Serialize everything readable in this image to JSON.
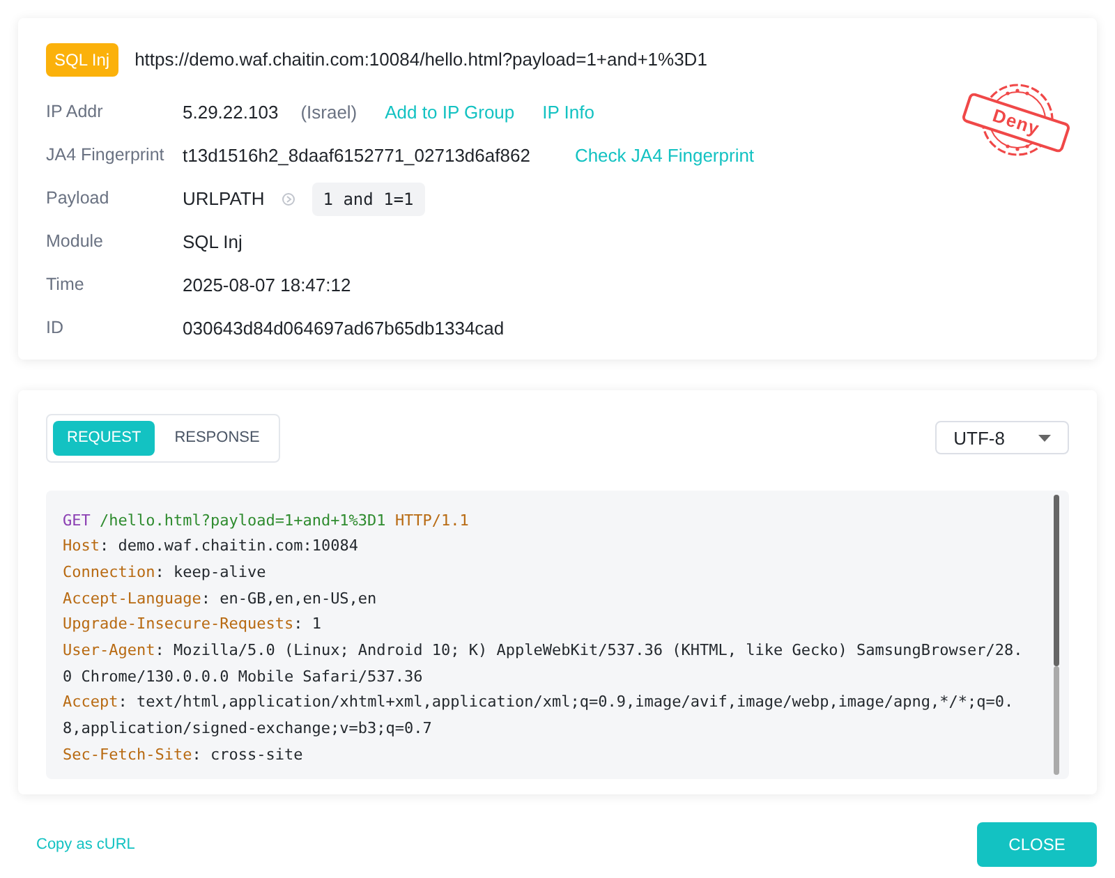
{
  "event": {
    "tag": "SQL Inj",
    "url": "https://demo.waf.chaitin.com:10084/hello.html?payload=1+and+1%3D1",
    "stamp": "Deny",
    "fields": [
      {
        "kind": "ip",
        "label": "IP Addr",
        "value": "5.29.22.103",
        "note": "(Israel)",
        "links": [
          "Add to IP Group",
          "IP Info"
        ]
      },
      {
        "kind": "fingerprint",
        "label": "JA4 Fingerprint",
        "value": "t13d1516h2_8daaf6152771_02713d6af862",
        "links": [
          "Check JA4 Fingerprint"
        ]
      },
      {
        "kind": "payload",
        "label": "Payload",
        "value": "URLPATH",
        "code": "1 and 1=1"
      },
      {
        "kind": "text",
        "label": "Module",
        "value": "SQL Inj"
      },
      {
        "kind": "text",
        "label": "Time",
        "value": "2025-08-07 18:47:12"
      },
      {
        "kind": "text",
        "label": "ID",
        "value": "030643d84d064697ad67b65db1334cad"
      }
    ]
  },
  "viewer": {
    "tabs": [
      {
        "label": "REQUEST",
        "selected": true
      },
      {
        "label": "RESPONSE",
        "selected": false
      }
    ],
    "encoding": "UTF-8",
    "separator": ":",
    "request_line": {
      "method": "GET",
      "path": "/hello.html?payload=1+and+1%3D1",
      "version": "HTTP/1.1"
    },
    "headers": [
      {
        "key": "Host",
        "value": "demo.waf.chaitin.com:10084"
      },
      {
        "key": "Connection",
        "value": "keep-alive"
      },
      {
        "key": "Accept-Language",
        "value": "en-GB,en,en-US,en"
      },
      {
        "key": "Upgrade-Insecure-Requests",
        "value": "1"
      },
      {
        "key": "User-Agent",
        "value": "Mozilla/5.0 (Linux; Android 10; K) AppleWebKit/537.36 (KHTML, like Gecko) SamsungBrowser/28.0 Chrome/130.0.0.0 Mobile Safari/537.36"
      },
      {
        "key": "Accept",
        "value": "text/html,application/xhtml+xml,application/xml;q=0.9,image/avif,image/webp,image/apng,*/*;q=0.8,application/signed-exchange;v=b3;q=0.7"
      },
      {
        "key": "Sec-Fetch-Site",
        "value": "cross-site"
      }
    ]
  },
  "footer": {
    "copy_link": "Copy as cURL",
    "close_button": "CLOSE"
  }
}
